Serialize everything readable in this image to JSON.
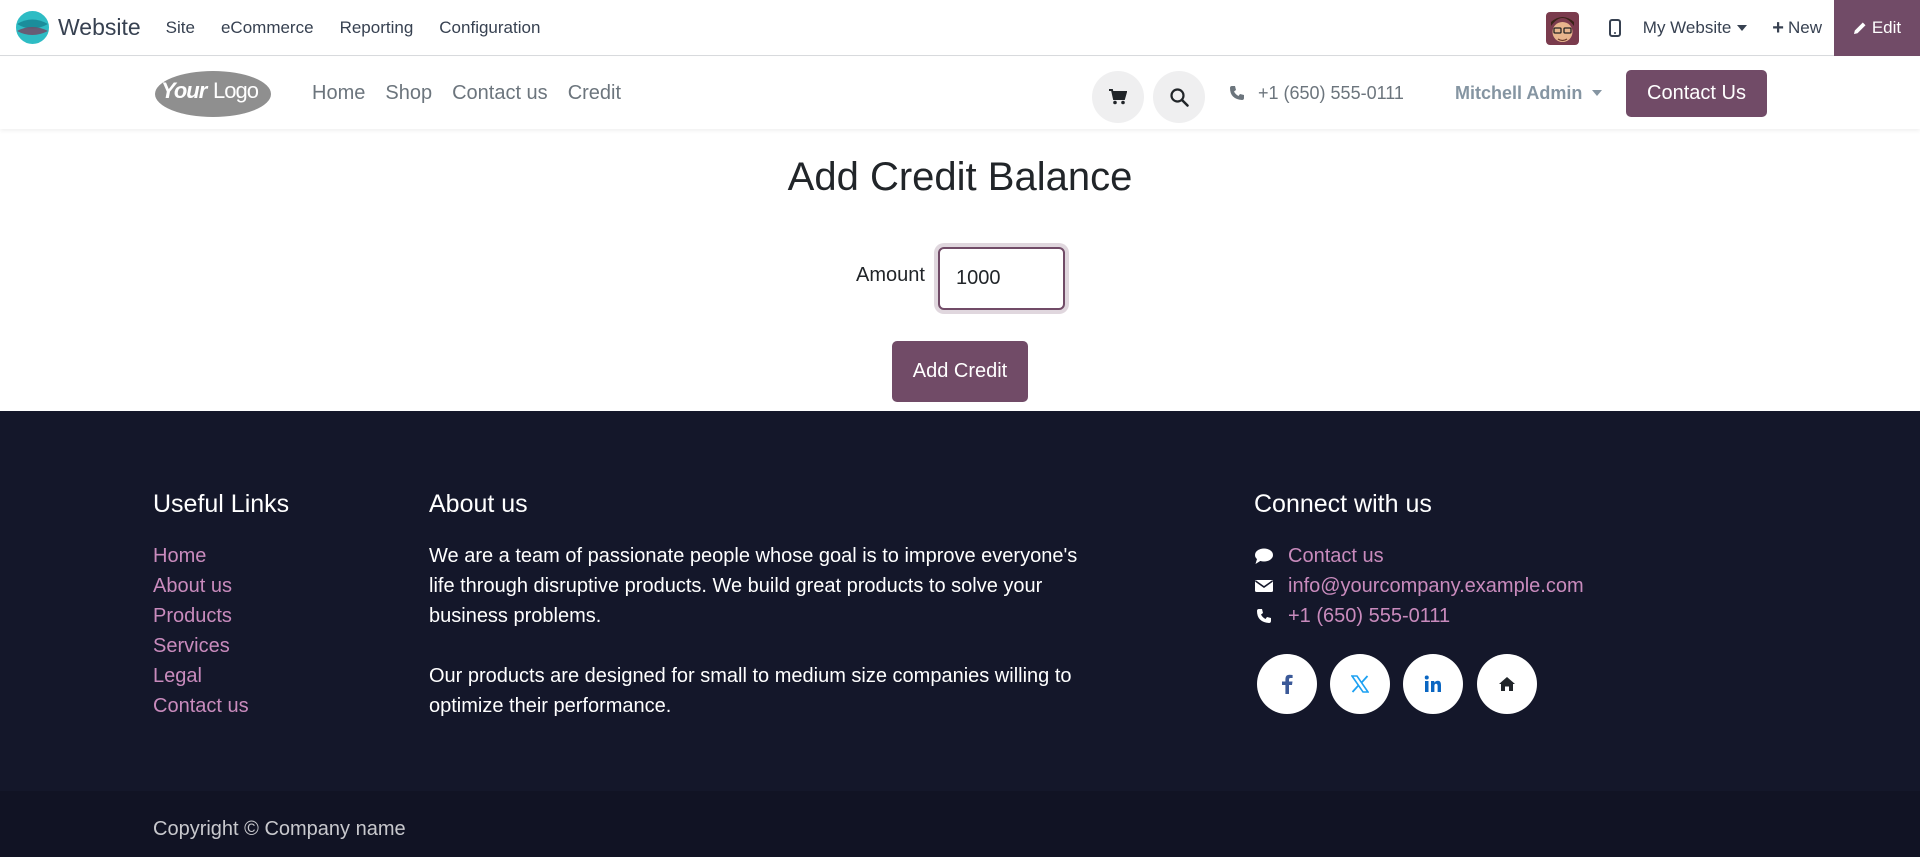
{
  "adminbar": {
    "app_name": "Website",
    "menu": [
      "Site",
      "eCommerce",
      "Reporting",
      "Configuration"
    ],
    "website_selector": "My Website",
    "new_label": "New",
    "edit_label": "Edit"
  },
  "header": {
    "logo_text": "YourLogo",
    "nav": [
      "Home",
      "Shop",
      "Contact us",
      "Credit"
    ],
    "phone": "+1 (650) 555-0111",
    "user": "Mitchell Admin",
    "contact_button": "Contact Us"
  },
  "main": {
    "title": "Add Credit Balance",
    "amount_label": "Amount",
    "amount_value": "1000",
    "submit_label": "Add Credit"
  },
  "footer": {
    "useful_links_title": "Useful Links",
    "useful_links": [
      "Home",
      "About us",
      "Products",
      "Services",
      "Legal",
      "Contact us"
    ],
    "about_title": "About us",
    "about_p1": "We are a team of passionate people whose goal is to improve everyone's life through disruptive products. We build great products to solve your business problems.",
    "about_p2": "Our products are designed for small to medium size companies willing to optimize their performance.",
    "connect_title": "Connect with us",
    "connect": {
      "contact": "Contact us",
      "email": "info@yourcompany.example.com",
      "phone": "+1 (650) 555-0111"
    },
    "social_icons": [
      "facebook-icon",
      "x-twitter-icon",
      "linkedin-icon",
      "home-icon"
    ],
    "copyright": "Copyright © Company name"
  },
  "colors": {
    "brand": "#714b67",
    "footer_bg": "#14172a",
    "footer_link": "#c98bbd"
  }
}
